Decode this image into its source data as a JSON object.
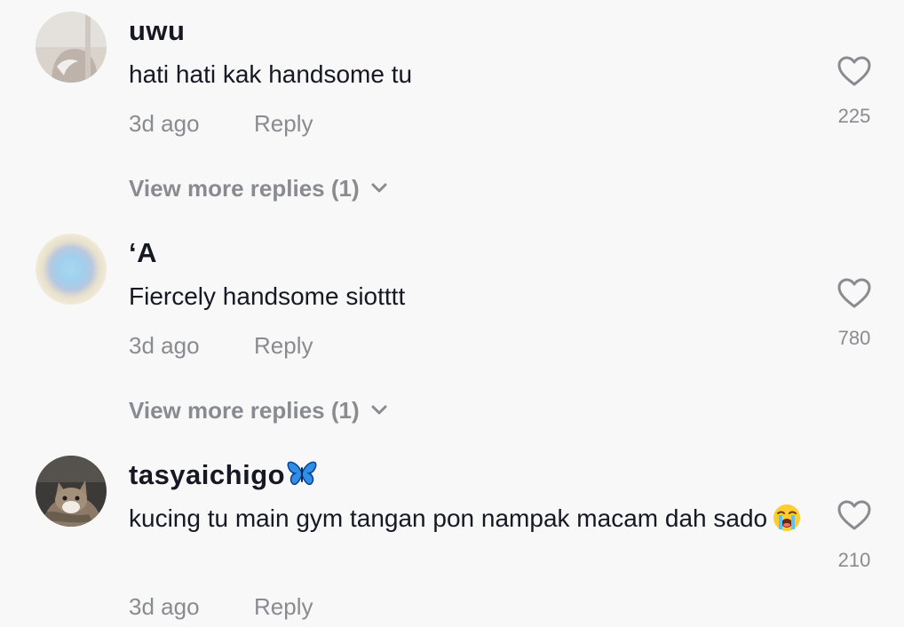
{
  "comments": [
    {
      "username": "uwu",
      "text": "hati hati kak handsome tu",
      "time": "3d ago",
      "reply_label": "Reply",
      "likes": "225",
      "view_more": "View more replies (1)"
    },
    {
      "username": "‘A",
      "text": "Fiercely handsome siotttt",
      "time": "3d ago",
      "reply_label": "Reply",
      "likes": "780",
      "view_more": "View more replies (1)"
    },
    {
      "username": "tasyaichigo",
      "username_emoji": "butterfly-emoji",
      "text": "kucing tu main gym tangan pon nampak macam dah sado",
      "text_emoji": "loudly-crying-face-emoji",
      "time": "3d ago",
      "reply_label": "Reply",
      "likes": "210"
    }
  ],
  "colors": {
    "background": "#f8f8f8",
    "primary_text": "#161823",
    "secondary_text": "#8a8b91"
  },
  "icons": {
    "like": "heart-outline-icon",
    "expand": "chevron-down-icon"
  }
}
